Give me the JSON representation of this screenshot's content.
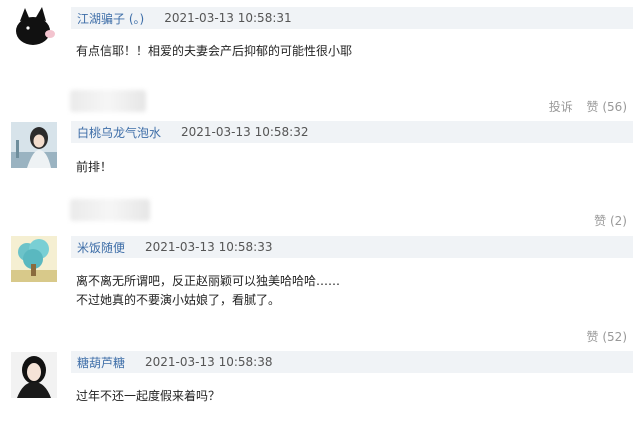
{
  "comments": [
    {
      "username": "江湖骗子 (。)",
      "timestamp": "2021-03-13 10:58:31",
      "text_lines": [
        "有点信耶！！相爱的夫妻会产后抑郁的可能性很小耶"
      ],
      "report_label": "投诉",
      "like_label": "赞 (56)",
      "avatar_icon": "cat-avatar-icon"
    },
    {
      "username": "白桃乌龙气泡水",
      "timestamp": "2021-03-13 10:58:32",
      "text_lines": [
        "前排！"
      ],
      "like_label": "赞 (2)",
      "avatar_icon": "girl-avatar-icon"
    },
    {
      "username": "米饭随便",
      "timestamp": "2021-03-13 10:58:33",
      "text_lines": [
        "离不离无所谓吧，反正赵丽颖可以独美哈哈哈……",
        "不过她真的不要演小姑娘了，看腻了。"
      ],
      "like_label": "赞 (52)",
      "avatar_icon": "tree-avatar-icon"
    },
    {
      "username": "糖葫芦糖",
      "timestamp": "2021-03-13 10:58:38",
      "text_lines": [
        "过年不还一起度假来着吗？"
      ],
      "avatar_icon": "woman-avatar-icon"
    }
  ],
  "colors": {
    "username": "#3e6ea8",
    "meta_bg": "#f0f3f6",
    "muted": "#999999"
  }
}
